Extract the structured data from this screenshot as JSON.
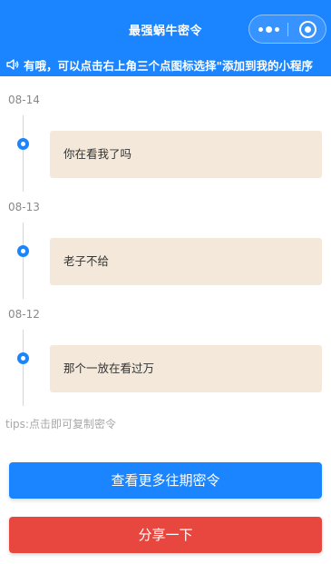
{
  "header": {
    "title": "最强蜗牛密令",
    "more_icon": "more-dots-icon",
    "close_icon": "target-close-icon"
  },
  "notice": {
    "icon": "speaker-icon",
    "text": "有哦，可以点击右上角三个点图标选择\"添加到我的小程序"
  },
  "timeline": [
    {
      "date": "08-14",
      "code": "你在看我了吗"
    },
    {
      "date": "08-13",
      "code": "老子不给"
    },
    {
      "date": "08-12",
      "code": "那个一放在看过万"
    }
  ],
  "tips": "tips:点击即可复制密令",
  "buttons": {
    "more_label": "查看更多往期密令",
    "share_label": "分享一下"
  },
  "colors": {
    "primary": "#1b84ff",
    "card_bg": "#f3e8da",
    "share": "#e8473f"
  }
}
